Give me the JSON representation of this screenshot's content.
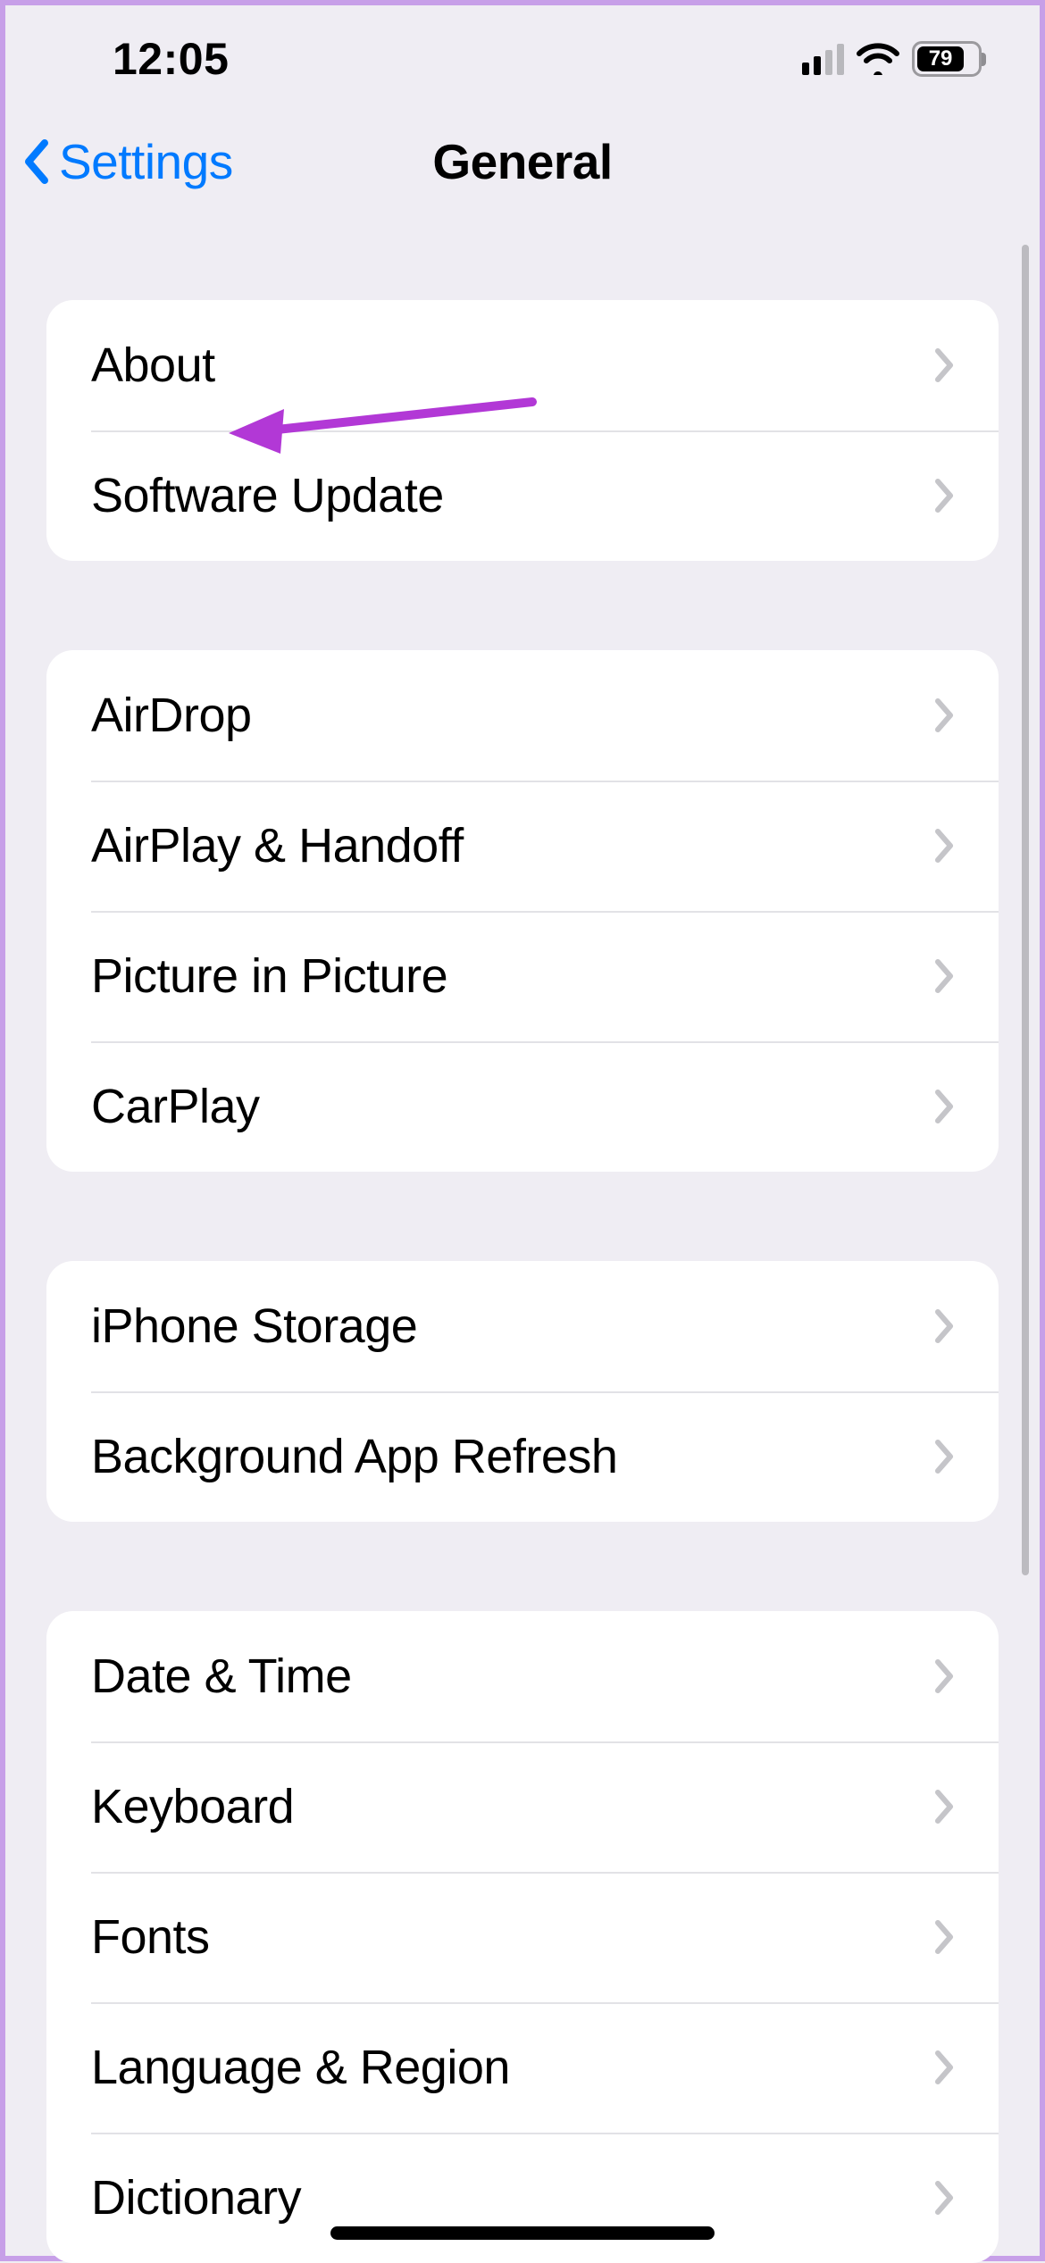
{
  "status_bar": {
    "time": "12:05",
    "battery_pct": "79"
  },
  "nav": {
    "back_label": "Settings",
    "title": "General"
  },
  "groups": [
    {
      "items": [
        {
          "id": "about",
          "label": "About"
        },
        {
          "id": "software-update",
          "label": "Software Update"
        }
      ]
    },
    {
      "items": [
        {
          "id": "airdrop",
          "label": "AirDrop"
        },
        {
          "id": "airplay-handoff",
          "label": "AirPlay & Handoff"
        },
        {
          "id": "pip",
          "label": "Picture in Picture"
        },
        {
          "id": "carplay",
          "label": "CarPlay"
        }
      ]
    },
    {
      "items": [
        {
          "id": "iphone-storage",
          "label": "iPhone Storage"
        },
        {
          "id": "bg-app-refresh",
          "label": "Background App Refresh"
        }
      ]
    },
    {
      "items": [
        {
          "id": "date-time",
          "label": "Date & Time"
        },
        {
          "id": "keyboard",
          "label": "Keyboard"
        },
        {
          "id": "fonts",
          "label": "Fonts"
        },
        {
          "id": "language-region",
          "label": "Language & Region"
        },
        {
          "id": "dictionary",
          "label": "Dictionary"
        }
      ]
    }
  ]
}
